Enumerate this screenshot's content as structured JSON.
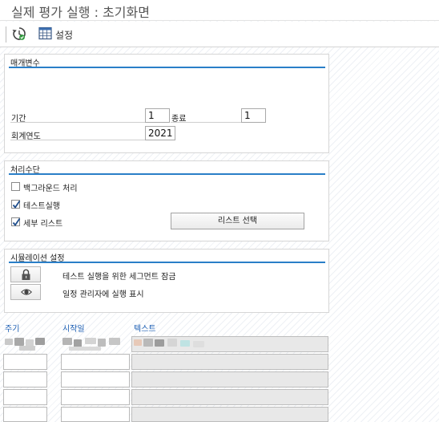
{
  "window": {
    "title": "실제 평가 실행 : 초기화면"
  },
  "toolbar": {
    "settings_label": "설정"
  },
  "parameters": {
    "title": "매개변수",
    "period_label": "기간",
    "period_from": "1",
    "end_label": "종료",
    "period_to": "1",
    "fiscal_year_label": "회계연도",
    "fiscal_year": "2021"
  },
  "processing": {
    "title": "처리수단",
    "background_label": "백그라운드 처리",
    "background_checked": false,
    "test_run_label": "테스트실행",
    "test_run_checked": true,
    "detail_list_label": "세부 리스트",
    "detail_list_checked": true,
    "list_select_button": "리스트 선택"
  },
  "simulation": {
    "title": "시뮬레이션 설정",
    "lock_label": "테스트 실행을 위한 세그먼트 잠금",
    "show_label": "일정 관리자에 실행 표시"
  },
  "table": {
    "columns": [
      "주기",
      "시작일",
      "텍스트"
    ],
    "row_count": 5
  },
  "colors": {
    "accent_line": "#2a7fc8",
    "column_header": "#1d5fb4"
  }
}
